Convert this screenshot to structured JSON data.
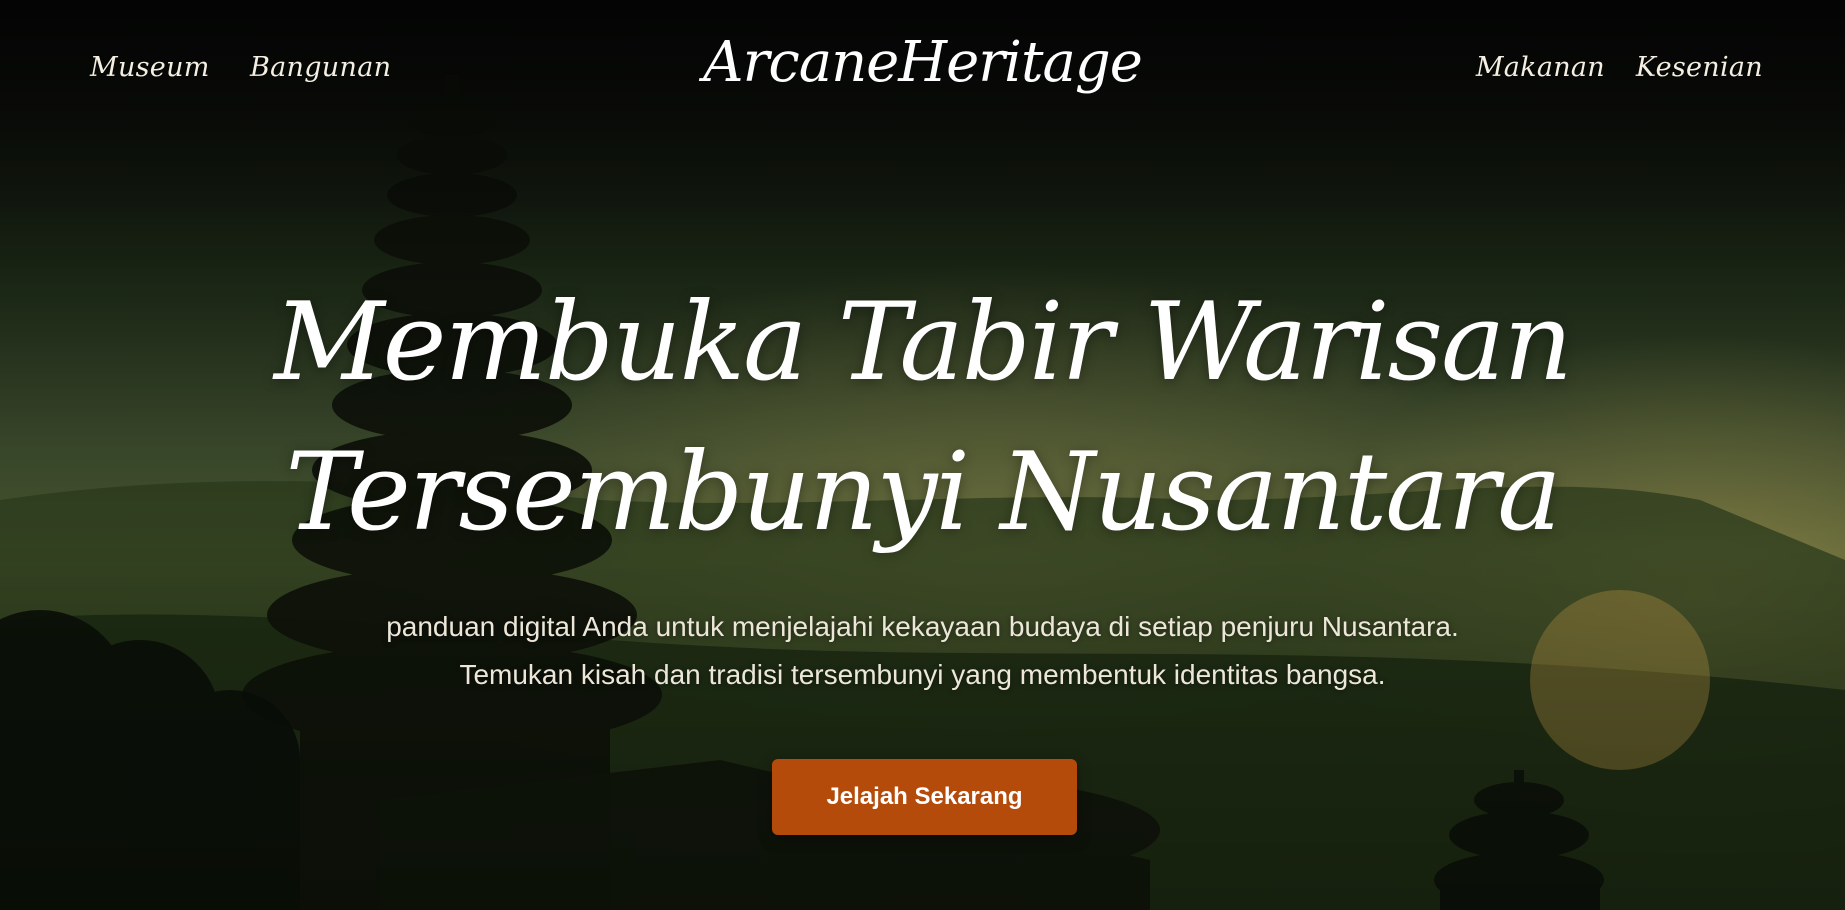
{
  "nav": {
    "left": [
      {
        "label": "Museum"
      },
      {
        "label": "Bangunan"
      }
    ],
    "brand": "ArcaneHeritage",
    "right": [
      {
        "label": "Makanan"
      },
      {
        "label": "Kesenian"
      }
    ]
  },
  "hero": {
    "headline_line1": "Membuka Tabir Warisan",
    "headline_line2": "Tersembunyi Nusantara",
    "subtitle_line1": "panduan digital Anda untuk menjelajahi kekayaan budaya di setiap penjuru Nusantara.",
    "subtitle_line2": "Temukan kisah dan tradisi tersembunyi yang membentuk identitas bangsa.",
    "cta_label": "Jelajah Sekarang",
    "cta_color": "#b54b0a"
  }
}
